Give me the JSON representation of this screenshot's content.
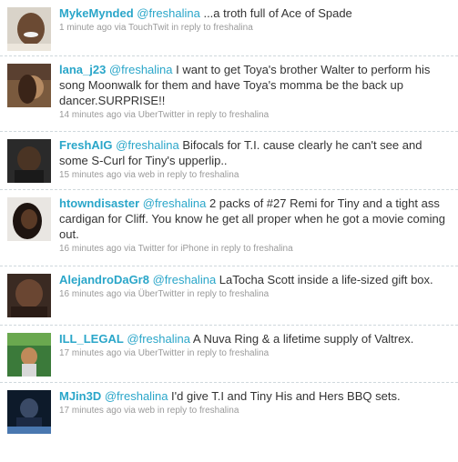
{
  "tweets": [
    {
      "user": "MykeMynded",
      "mention": "@freshalina",
      "text": " ...a troth full of Ace of Spade",
      "time": "1 minute ago",
      "via_prefix": " via ",
      "source": "TouchTwit",
      "reply_prefix": " in reply to ",
      "reply_to": "freshalina"
    },
    {
      "user": "lana_j23",
      "mention": "@freshalina",
      "text": " I want to get Toya's brother Walter to perform his song Moonwalk for them and have Toya's momma be the back up dancer.SURPRISE!!",
      "time": "14 minutes ago",
      "via_prefix": " via ",
      "source": "UberTwitter",
      "reply_prefix": " in reply to ",
      "reply_to": "freshalina"
    },
    {
      "user": "FreshAIG",
      "mention": "@freshalina",
      "text": " Bifocals for T.I. cause clearly he can't see and some S-Curl for Tiny's upperlip..",
      "time": "15 minutes ago",
      "via_prefix": " via ",
      "source": "web",
      "reply_prefix": " in reply to ",
      "reply_to": "freshalina"
    },
    {
      "user": "htowndisaster",
      "mention": "@freshalina",
      "text": " 2 packs of #27 Remi for Tiny and a tight ass cardigan for Cliff. You know he get all proper when he got a movie coming out.",
      "time": "16 minutes ago",
      "via_prefix": " via ",
      "source": "Twitter for iPhone",
      "reply_prefix": " in reply to ",
      "reply_to": "freshalina"
    },
    {
      "user": "AlejandroDaGr8",
      "mention": "@freshalina",
      "text": " LaTocha Scott inside a life-sized gift box.",
      "time": "16 minutes ago",
      "via_prefix": " via ",
      "source": "ÜberTwitter",
      "reply_prefix": " in reply to ",
      "reply_to": "freshalina"
    },
    {
      "user": "ILL_LEGAL",
      "mention": "@freshalina",
      "text": " A Nuva Ring & a lifetime supply of Valtrex.",
      "time": "17 minutes ago",
      "via_prefix": " via ",
      "source": "UberTwitter",
      "reply_prefix": " in reply to ",
      "reply_to": "freshalina"
    },
    {
      "user": "MJin3D",
      "mention": "@freshalina",
      "text": " I'd give T.I and Tiny His and Hers BBQ sets.",
      "time": "17 minutes ago",
      "via_prefix": " via ",
      "source": "web",
      "reply_prefix": " in reply to ",
      "reply_to": "freshalina"
    }
  ],
  "colors": {
    "link": "#2aa6c9",
    "text": "#333333",
    "meta": "#9a9a9a",
    "divider": "#cfd8dc"
  }
}
